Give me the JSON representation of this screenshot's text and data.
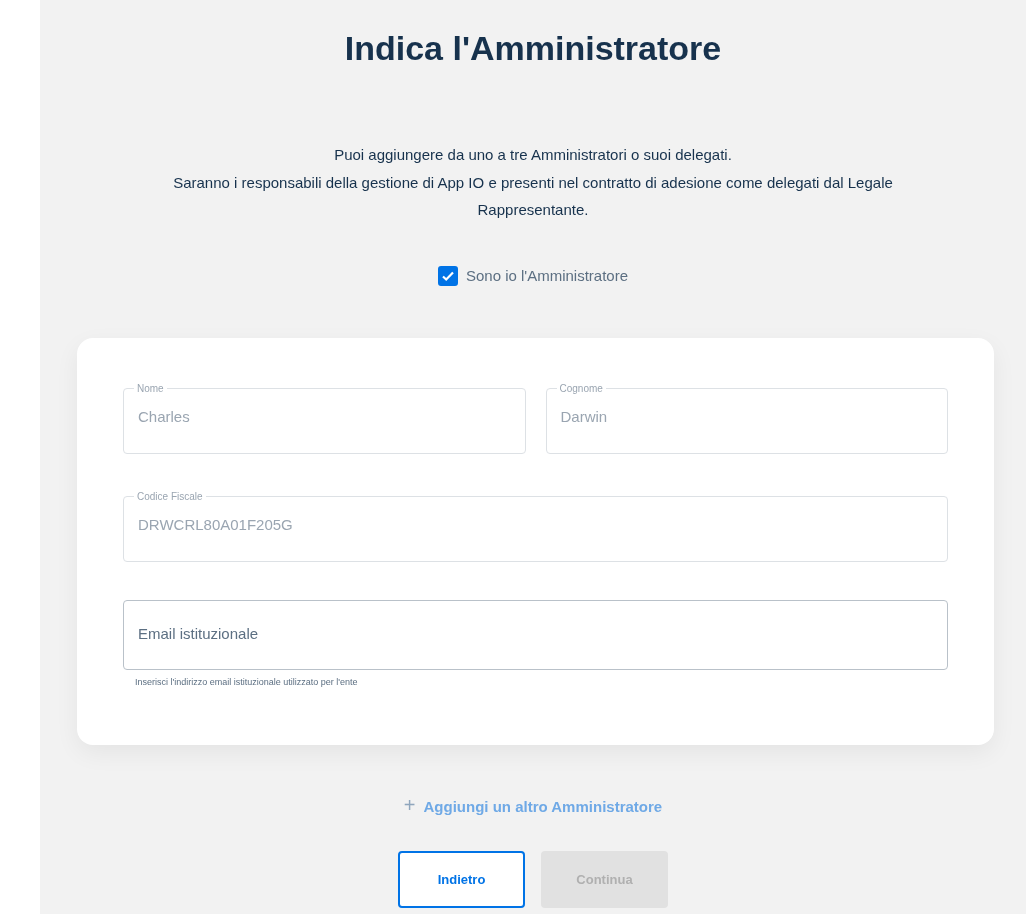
{
  "title": "Indica l'Amministratore",
  "description": [
    "Puoi aggiungere da uno a tre Amministratori o suoi delegati.",
    "Saranno i responsabili della gestione di App IO e presenti nel contratto di adesione come delegati dal Legale Rappresentante."
  ],
  "self_admin": {
    "label": "Sono io l'Amministratore",
    "checked": true
  },
  "fields": [
    {
      "label": "Nome",
      "value": "Charles",
      "disabled": true,
      "half": true
    },
    {
      "label": "Cognome",
      "value": "Darwin",
      "disabled": true,
      "half": true
    },
    {
      "label": "Codice Fiscale",
      "value": "DRWCRL80A01F205G",
      "disabled": true,
      "half": false
    },
    {
      "placeholder": "Email istituzionale",
      "helper": "Inserisci l'indirizzo email istituzionale utilizzato per l'ente",
      "disabled": false,
      "half": false
    }
  ],
  "add_link": {
    "icon": "+",
    "label": "Aggiungi un altro Amministratore"
  },
  "buttons": [
    {
      "label": "Indietro",
      "kind": "outline",
      "disabled": false
    },
    {
      "label": "Continua",
      "kind": "primary",
      "disabled": true
    }
  ]
}
